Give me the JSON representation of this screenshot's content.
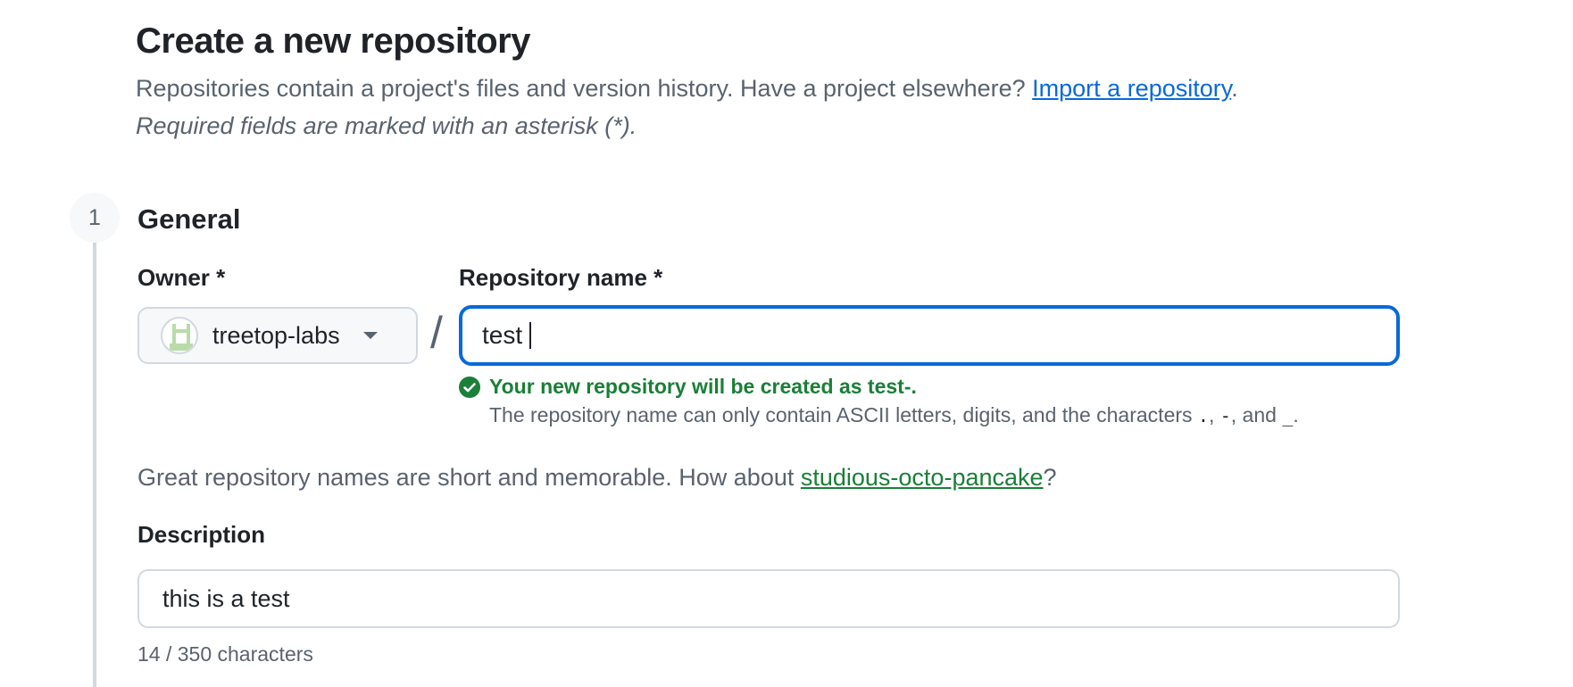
{
  "header": {
    "title": "Create a new repository",
    "intro_text": "Repositories contain a project's files and version history. Have a project elsewhere? ",
    "import_link": "Import a repository",
    "intro_end": ".",
    "required_note": "Required fields are marked with an asterisk (*)."
  },
  "section": {
    "step_number": "1",
    "title": "General"
  },
  "owner": {
    "label": "Owner *",
    "value": "treetop-labs"
  },
  "separator": "/",
  "repo_name": {
    "label": "Repository name *",
    "value": "test"
  },
  "validation": {
    "success": "Your new repository will be created as test-.",
    "rule_prefix": "The repository name can only contain ASCII letters, digits, and the characters ",
    "char_dot": ".",
    "sep1": ", ",
    "char_dash": "-",
    "sep2": ", and ",
    "char_underscore": "_",
    "rule_end": "."
  },
  "suggestion": {
    "prefix": "Great repository names are short and memorable. How about ",
    "name": "studious-octo-pancake",
    "suffix": "?"
  },
  "description": {
    "label": "Description",
    "value": "this is a test",
    "char_count": "14 / 350 characters"
  },
  "colors": {
    "accent_blue": "#0969da",
    "success_green": "#1a7f37",
    "muted_text": "#59636e"
  }
}
